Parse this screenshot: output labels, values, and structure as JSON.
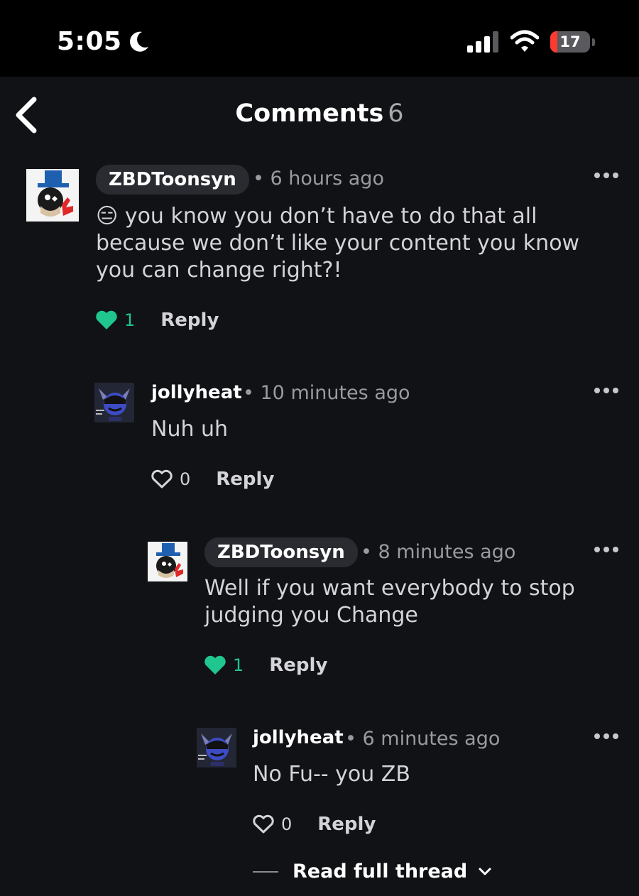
{
  "status": {
    "time": "5:05",
    "battery": "17"
  },
  "header": {
    "title": "Comments",
    "count": "6"
  },
  "comments": [
    {
      "username": "ZBDToonsyn",
      "time": "• 6 hours ago",
      "emoji": "😑",
      "text": " you know you don’t have to do that all because we don’t like your content you know you can change right?!",
      "likes": "1",
      "reply": "Reply"
    },
    {
      "username": "jollyheat",
      "time": "• 10 minutes ago",
      "text": "Nuh uh",
      "likes": "0",
      "reply": "Reply"
    },
    {
      "username": "ZBDToonsyn",
      "time": "• 8 minutes ago",
      "text": "Well if you want everybody to stop judging you Change",
      "likes": "1",
      "reply": "Reply"
    },
    {
      "username": "jollyheat",
      "time": "• 6 minutes ago",
      "text": "No Fu-- you ZB",
      "likes": "0",
      "reply": "Reply"
    }
  ],
  "thread": {
    "label": "Read full thread"
  },
  "colors": {
    "accent": "#1fc68d",
    "background": "#111216",
    "pill": "#2a2b30"
  }
}
